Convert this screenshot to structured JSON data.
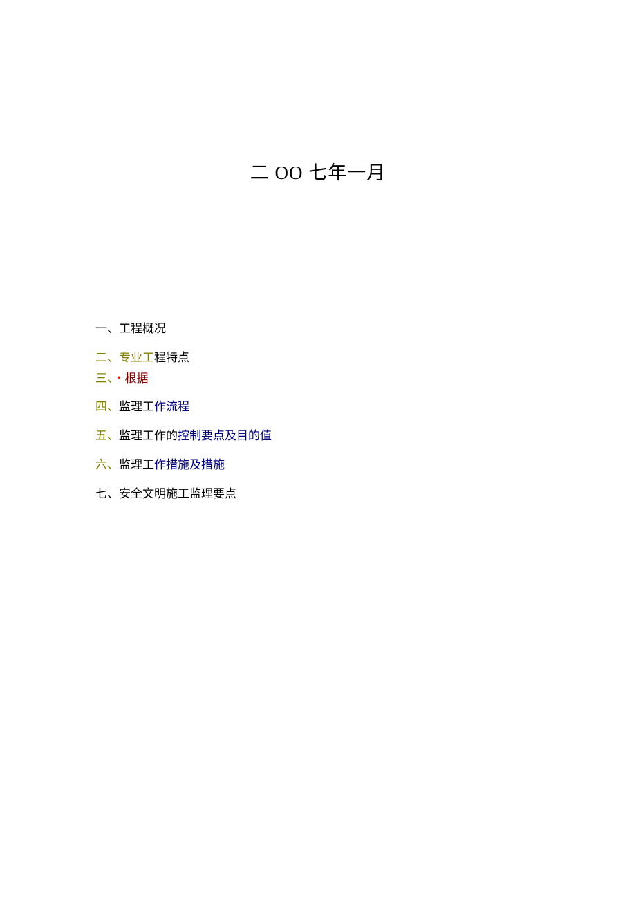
{
  "title": "二 OO 七年一月",
  "toc": {
    "items": [
      {
        "num": "一、",
        "text": "工程概况"
      },
      {
        "num": "二、",
        "label": "专业工",
        "rest": "程特点"
      },
      {
        "num": "三、",
        "bullet": "・",
        "text": "根据"
      },
      {
        "num": "四、",
        "label": "监理工",
        "rest": "作流程"
      },
      {
        "num": "五、",
        "label": "监理工作的",
        "rest": "控制要点及目的值"
      },
      {
        "num": "六、",
        "label": "监理工",
        "rest": "作措施及措施"
      },
      {
        "num": "七、",
        "text": "安全文明施工监理要点"
      }
    ]
  }
}
